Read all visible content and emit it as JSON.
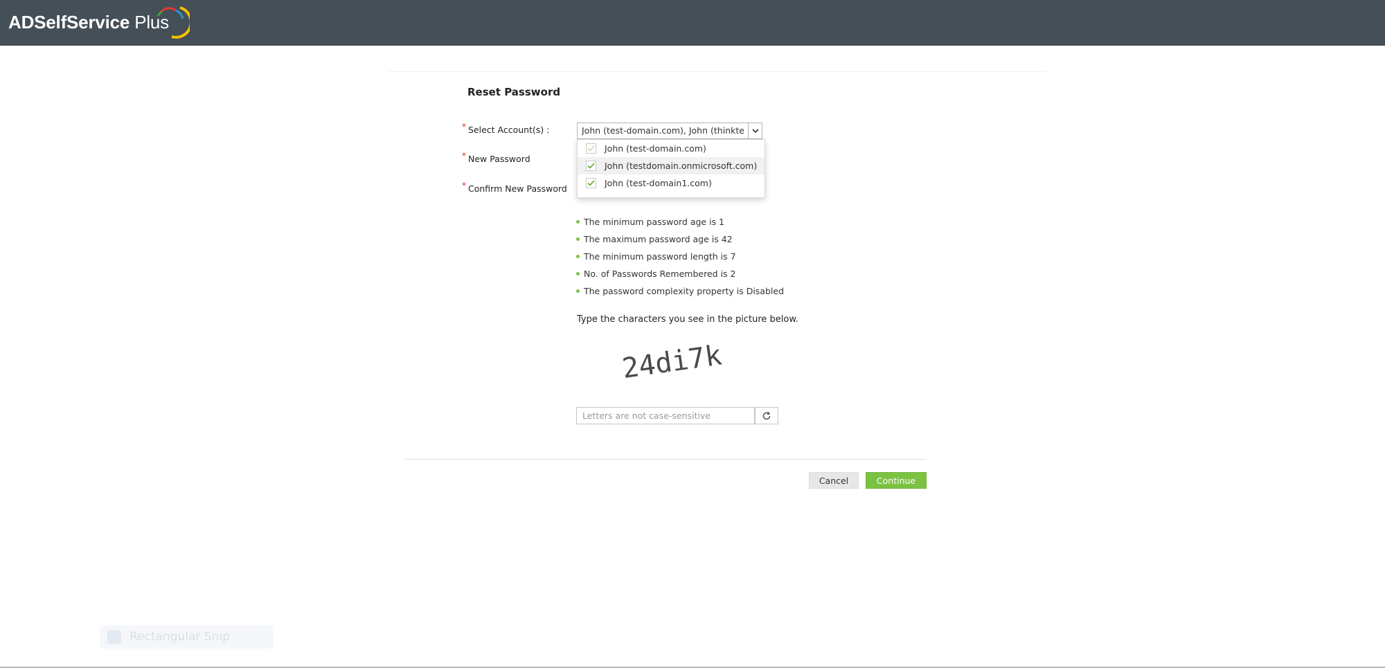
{
  "app": {
    "logo_main": "ADSelfService",
    "logo_plus": " Plus"
  },
  "form": {
    "title": "Reset Password",
    "required_marker": "*",
    "select_label": "Select Account(s) :",
    "new_password_label": "New Password",
    "confirm_password_label": "Confirm New Password",
    "selected_accounts_value": "John (test-domain.com), John (thinkte",
    "account_options": [
      {
        "label": "John (test-domain.com)",
        "checked": true,
        "disabled": true
      },
      {
        "label": "John (testdomain.onmicrosoft.com)",
        "checked": true,
        "disabled": false
      },
      {
        "label": "John (test-domain1.com)",
        "checked": true,
        "disabled": false
      }
    ]
  },
  "policy": {
    "rules": [
      "The minimum password age is 1",
      "The maximum password age is 42",
      "The minimum password length is 7",
      "No. of Passwords Remembered is 2",
      "The password complexity property is Disabled"
    ]
  },
  "captcha": {
    "prompt": "Type the characters you see in the picture below.",
    "image_text": "24di7k",
    "input_placeholder": "Letters are not case-sensitive"
  },
  "buttons": {
    "cancel": "Cancel",
    "continue": "Continue"
  },
  "overlay": {
    "snip_label": "Rectangular Snip"
  },
  "colors": {
    "topbar": "#454f57",
    "accent_green": "#7cc242",
    "required_red": "#e0301e"
  }
}
